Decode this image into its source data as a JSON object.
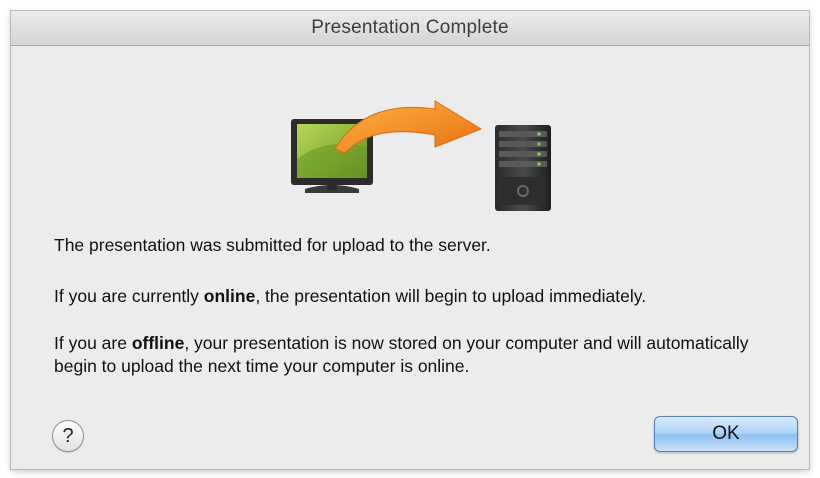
{
  "dialog": {
    "title": "Presentation Complete",
    "illustration": {
      "left_icon": "monitor-icon",
      "arrow_icon": "curved-arrow-icon",
      "right_icon": "server-icon"
    },
    "message_1": "The presentation was submitted for upload to the server.",
    "message_2": {
      "before": "If you are currently ",
      "bold": "online",
      "after": ", the presentation will begin to upload immediately."
    },
    "message_3": {
      "before": "If you are ",
      "bold": "offline",
      "after": ", your presentation is now stored on your computer and will automatically begin to upload the next time your computer is online."
    },
    "help_label": "?",
    "ok_label": "OK"
  },
  "colors": {
    "arrow": "#f08a1c",
    "ok_button": "#aed3f7",
    "monitor_screen": "#8fb83a"
  }
}
